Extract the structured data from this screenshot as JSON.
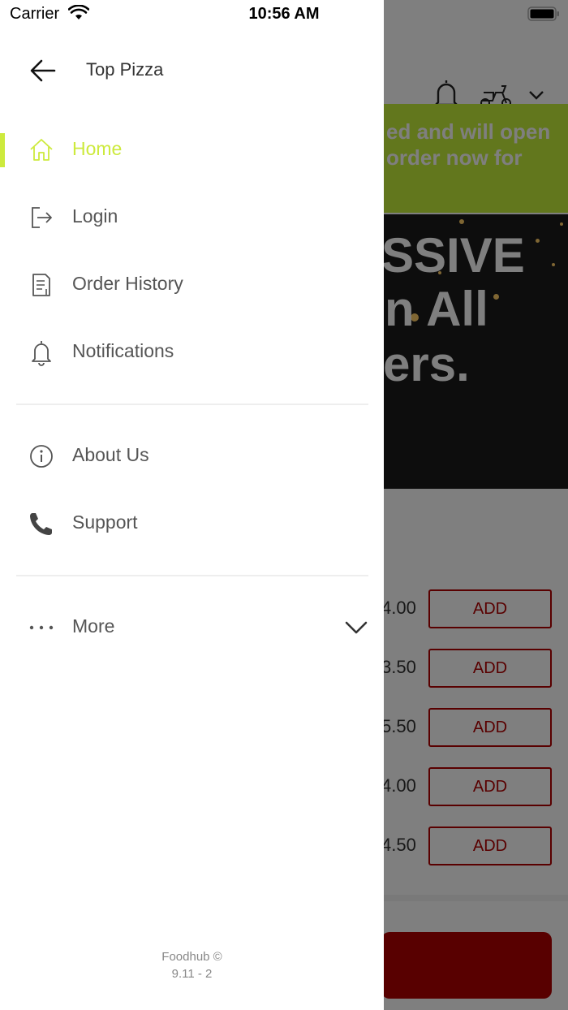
{
  "status_bar": {
    "carrier": "Carrier",
    "time": "10:56 AM"
  },
  "drawer": {
    "title": "Top Pizza",
    "accent_color": "#cdea3d",
    "menu": [
      {
        "label": "Home",
        "icon": "home-icon",
        "active": true
      },
      {
        "label": "Login",
        "icon": "login-icon"
      },
      {
        "label": "Order History",
        "icon": "order-history-icon"
      },
      {
        "label": "Notifications",
        "icon": "bell-icon"
      },
      {
        "label": "About Us",
        "icon": "info-icon"
      },
      {
        "label": "Support",
        "icon": "phone-icon"
      },
      {
        "label": "More",
        "icon": "more-dots-icon"
      }
    ],
    "footer": {
      "line1": "Foodhub ©",
      "line2": "9.11 - 2"
    }
  },
  "background": {
    "banner_line1": "ed and will open",
    "banner_line2": "order now for",
    "promo": [
      "SSIVE",
      "n All",
      "ers."
    ],
    "items": [
      {
        "price": "4.00",
        "action": "ADD"
      },
      {
        "price": "3.50",
        "action": "ADD"
      },
      {
        "price": "5.50",
        "action": "ADD"
      },
      {
        "price": "4.00",
        "action": "ADD"
      },
      {
        "price": "4.50",
        "action": "ADD"
      }
    ],
    "brand_color": "#b30000"
  }
}
